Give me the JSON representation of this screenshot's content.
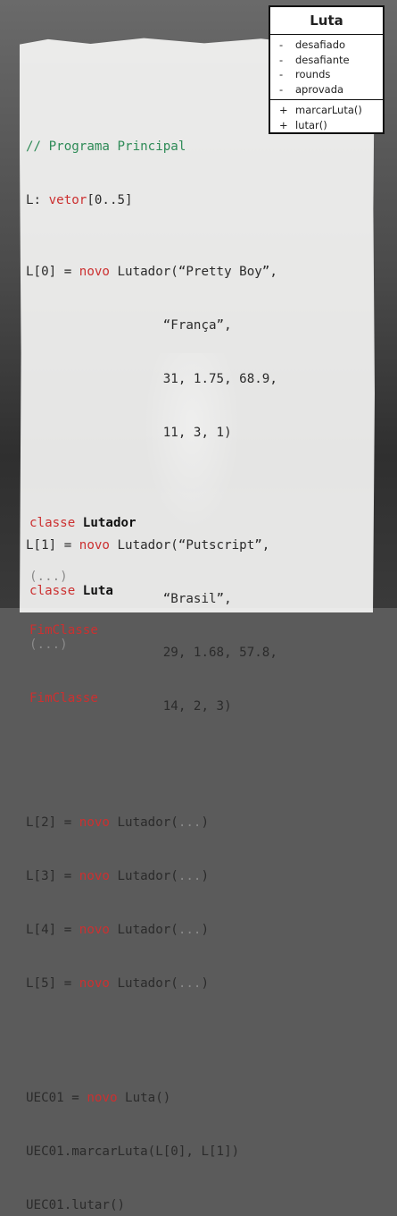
{
  "uml": {
    "title": "Luta",
    "attributes": [
      {
        "vis": "-",
        "name": "desafiado"
      },
      {
        "vis": "-",
        "name": "desafiante"
      },
      {
        "vis": "-",
        "name": "rounds"
      },
      {
        "vis": "-",
        "name": "aprovada"
      }
    ],
    "methods": [
      {
        "vis": "+",
        "name": "marcarLuta()"
      },
      {
        "vis": "+",
        "name": "lutar()"
      }
    ]
  },
  "code": {
    "comment": "// Programa Principal",
    "decl_prefix": "L: ",
    "decl_kw": "vetor",
    "decl_suffix": "[0..5]",
    "l0_a": "L[0] = ",
    "kw_novo": "novo",
    "l0_b": " Lutador(“Pretty Boy”,",
    "l0_c": "                  “França”,",
    "l0_d": "                  31, 1.75, 68.9,",
    "l0_e": "                  11, 3, 1)",
    "l1_a": "L[1] = ",
    "l1_b": " Lutador(“Putscript”,",
    "l1_c": "                  “Brasil”,",
    "l1_d": "                  29, 1.68, 57.8,",
    "l1_e": "                  14, 2, 3)",
    "l2_a": "L[2] = ",
    "l3_a": "L[3] = ",
    "l4_a": "L[4] = ",
    "l5_a": "L[5] = ",
    "lutador_call": " Lutador(",
    "ellipsis": "...",
    "close_paren": ")",
    "uec_a": "UEC01 = ",
    "uec_b": " Luta()",
    "uec_marcar": "UEC01.marcarLuta(L[0], L[1])",
    "uec_lutar": "UEC01.lutar()"
  },
  "classes": [
    {
      "kw": "classe",
      "name": "Lutador",
      "body": "(...)",
      "end": "FimClasse"
    },
    {
      "kw": "classe",
      "name": "Luta",
      "body": "(...)",
      "end": "FimClasse"
    }
  ]
}
